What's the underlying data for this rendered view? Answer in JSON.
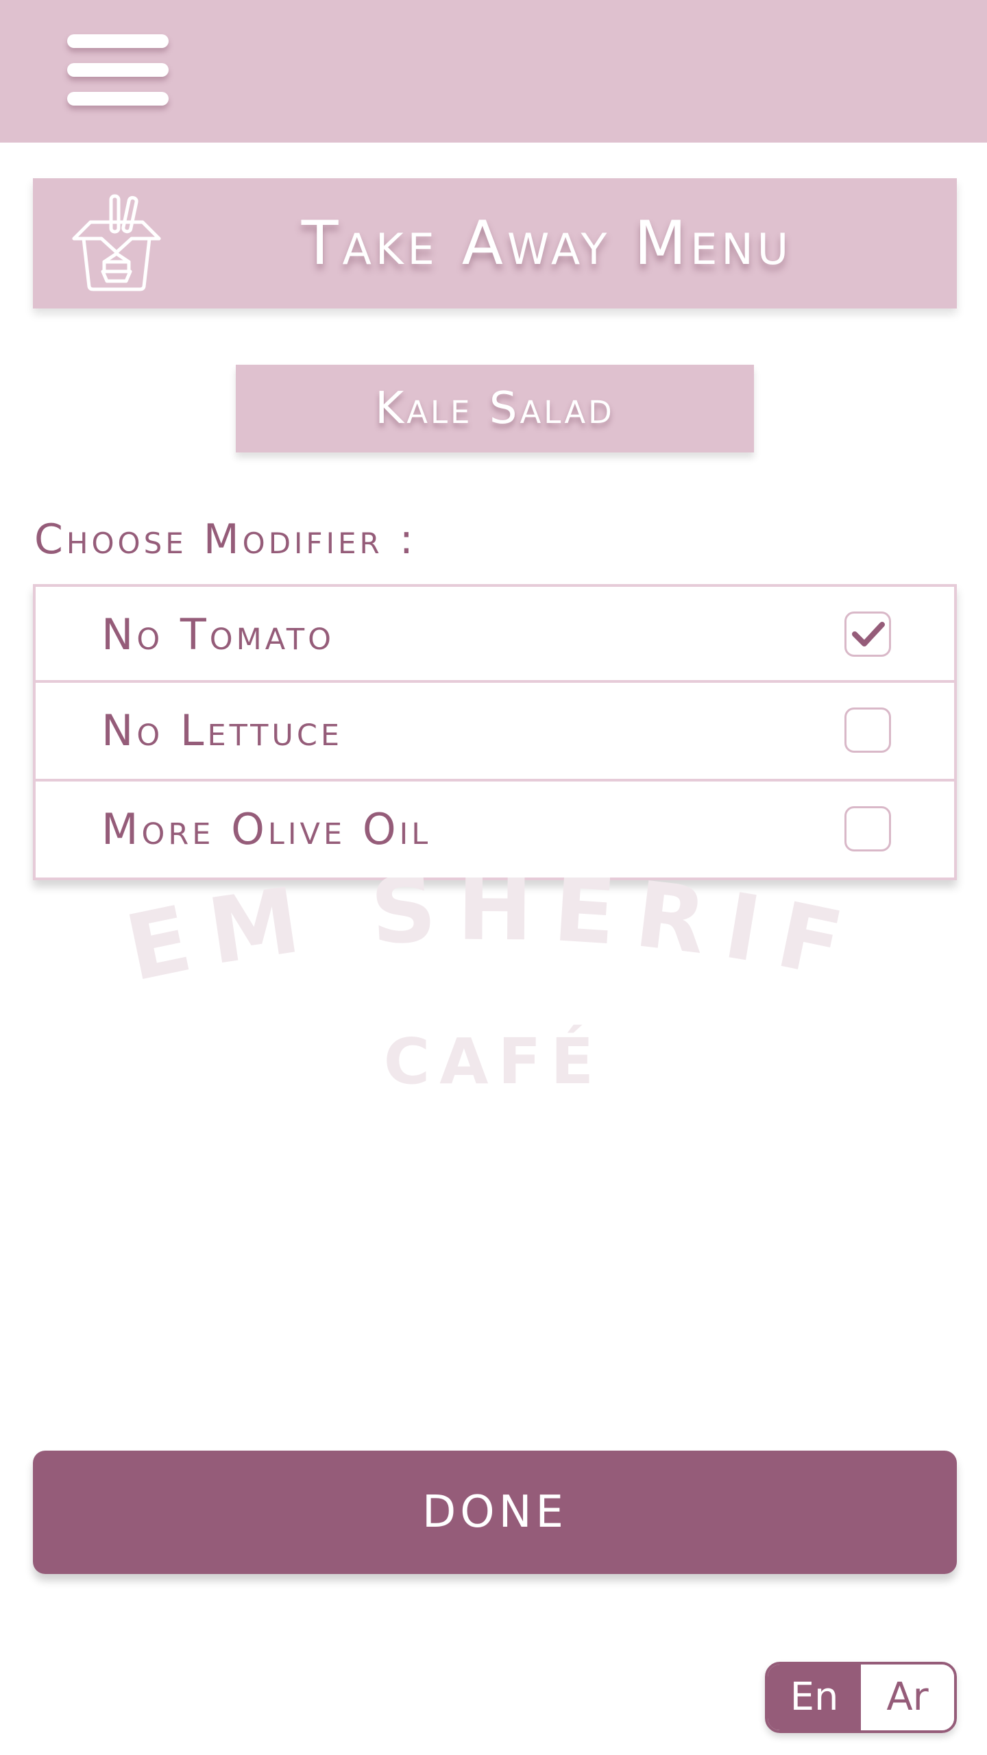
{
  "header": {
    "menu_icon": "hamburger-menu-icon"
  },
  "banner": {
    "icon": "takeaway-box-icon",
    "title": "Take Away Menu"
  },
  "item": {
    "name": "Kale Salad"
  },
  "modifiers": {
    "label": "Choose Modifier :",
    "options": [
      {
        "label": "No Tomato",
        "checked": true
      },
      {
        "label": "No Lettuce",
        "checked": false
      },
      {
        "label": "More Olive Oil",
        "checked": false
      }
    ]
  },
  "watermark": {
    "line1": "EM SHERIF",
    "line2": "CAFÉ"
  },
  "actions": {
    "done_label": "DONE"
  },
  "language": {
    "options": [
      "En",
      "Ar"
    ],
    "selected": "En"
  },
  "colors": {
    "primary": "#955c79",
    "light": "#dfc1cf",
    "border": "#e6cbd8"
  }
}
